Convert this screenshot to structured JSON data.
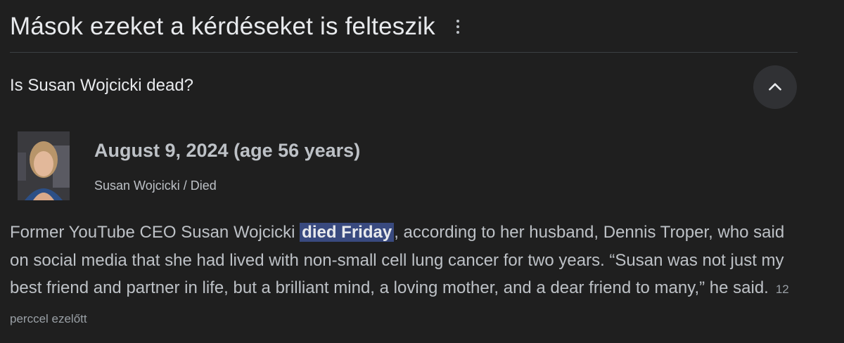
{
  "section": {
    "title": "Mások ezeket a kérdéseket is felteszik",
    "more_icon": "more-vert-icon"
  },
  "question": {
    "text": "Is Susan Wojcicki dead?",
    "toggle_icon": "chevron-up-icon"
  },
  "answer": {
    "main": "August 9, 2024 (age 56 years)",
    "entity": "Susan Wojcicki",
    "separator": " / ",
    "attribute": "Died"
  },
  "snippet": {
    "before": "Former YouTube CEO Susan Wojcicki ",
    "highlight": "died Friday",
    "after": ", according to her husband, Dennis Troper, who said on social media that she had lived with non-small cell lung cancer for two years. “Susan was not just my best friend and partner in life, but a brilliant mind, a loving mother, and a dear friend to many,” he said.",
    "time": "12 perccel ezelőtt"
  },
  "colors": {
    "background": "#1f1f1f",
    "highlight": "#394a7f",
    "text": "#bdc1c6"
  }
}
